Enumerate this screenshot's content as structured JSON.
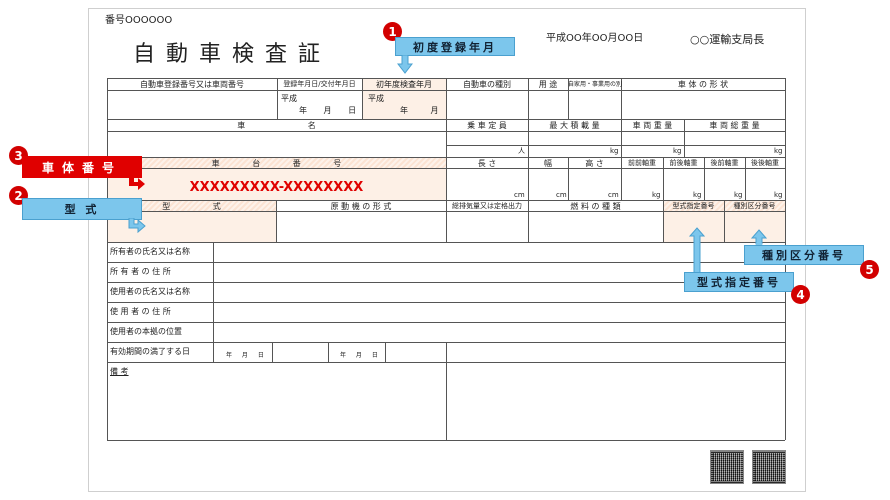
{
  "doc_number": "番号OOOOOO",
  "title": "自 動 車 検 査 証",
  "issue_date": "平成OO年OO月OO日",
  "issuer": "○○運輸支局長",
  "header_row": {
    "reg_no": "自動車登録番号又は車両番号",
    "reg_date": "登録年月日/交付年月日",
    "first_reg": "初年度検査年月",
    "kind": "自動車の種別",
    "use": "用 途",
    "private_business": "自家用・事業用の別",
    "body_shape": "車 体 の 形 状"
  },
  "era_1": "平成",
  "ymd_1": "年 月 日",
  "era_2": "平成",
  "ym_2": "年 月",
  "row2": {
    "name": "車 名",
    "capacity": "乗 車 定 員",
    "max_load": "最 大 積 載 量",
    "weight": "車 両 重 量",
    "gross_weight": "車 両 総 重 量"
  },
  "unit_person": "人",
  "unit_kg": "kg",
  "row3": {
    "chassis": "車 台 番 号",
    "length": "長 さ",
    "width": "幅",
    "height": "高 さ",
    "ff_axle": "前前軸重",
    "fr_axle": "前後軸重",
    "rf_axle": "後前軸重",
    "rr_axle": "後後軸重"
  },
  "chassis_value": "XXXXXXXXX-XXXXXXXX",
  "unit_cm": "cm",
  "row4": {
    "model": "型 式",
    "engine": "原 動 機 の 形 式",
    "displacement": "総排気量又は定格出力",
    "fuel": "燃 料 の 種 類",
    "model_designation": "型式指定番号",
    "category_number": "種別区分番号"
  },
  "owner_rows": [
    "所有者の氏名又は名称",
    "所 有 者 の 住 所",
    "使用者の氏名又は名称",
    "使 用 者 の 住 所",
    "使用者の本拠の位置",
    "有効期間の満了する日"
  ],
  "expiry_ymd": "年 月 日",
  "remarks": "備 考",
  "callouts": [
    {
      "num": "1",
      "label": "初度登録年月"
    },
    {
      "num": "2",
      "label": "型 式"
    },
    {
      "num": "3",
      "label": "車体番号"
    },
    {
      "num": "4",
      "label": "型式指定番号"
    },
    {
      "num": "5",
      "label": "種別区分番号"
    }
  ],
  "colors": {
    "callout_blue": "#7cc6ec",
    "callout_red": "#e00000",
    "highlight": "#fdf0e6"
  }
}
